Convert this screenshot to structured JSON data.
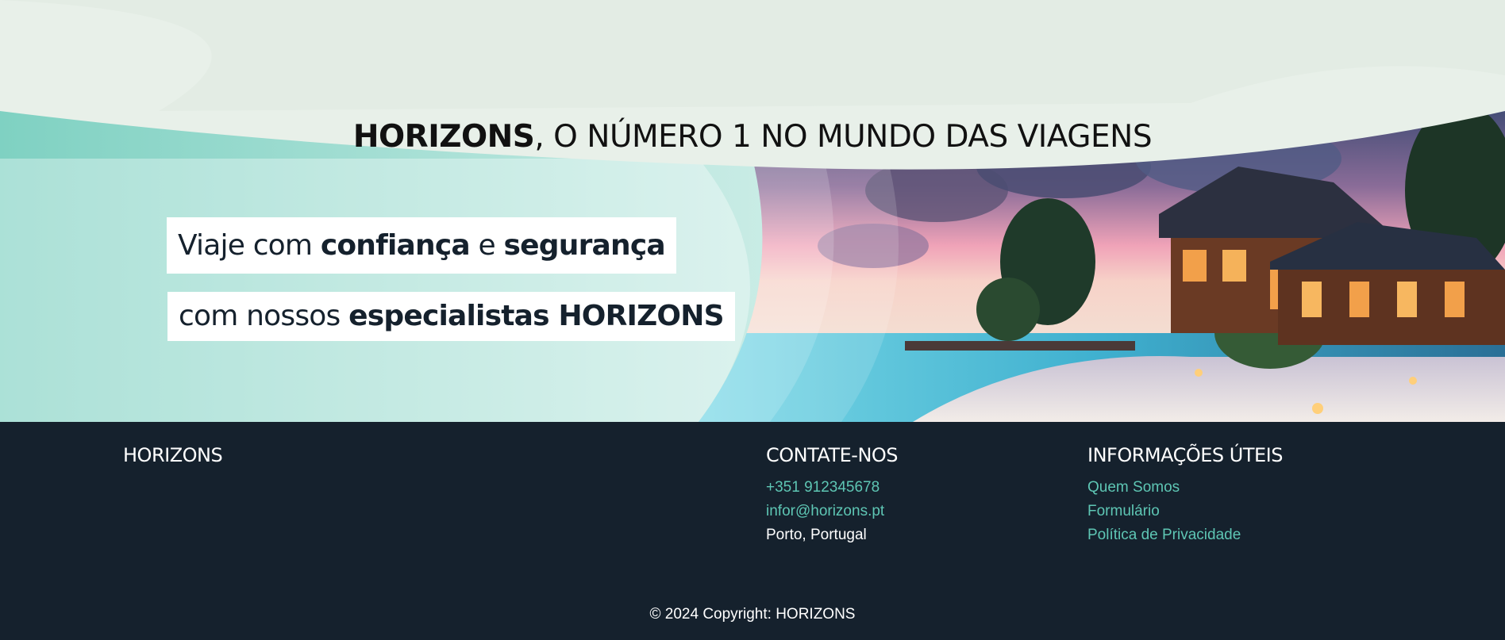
{
  "hero": {
    "headline_brand": "HORIZONS",
    "headline_rest": ", O NÚMERO 1 NO MUNDO DAS VIAGENS",
    "tagline_one": {
      "part1": "Viaje com ",
      "bold1": "confiança",
      "part2": " e ",
      "bold2": "segurança"
    },
    "tagline_two": {
      "part1": "com nossos ",
      "bold1": "especialistas HORIZONS"
    },
    "image_alt": "beach-villa-sunset-photo"
  },
  "footer": {
    "brand": "HORIZONS",
    "contact": {
      "heading": "CONTATE-NOS",
      "phone": "+351 912345678",
      "email": "infor@horizons.pt",
      "location": "Porto, Portugal"
    },
    "info": {
      "heading": "INFORMAÇÕES ÚTEIS",
      "links": [
        "Quem Somos",
        "Formulário",
        "Política de Privacidade"
      ]
    },
    "copyright": "© 2024 Copyright: HORIZONS"
  },
  "colors": {
    "footer_bg": "#15212d",
    "link": "#5ec6b4",
    "teal": "#7fd1c2",
    "wave": "#e8f0e9"
  }
}
